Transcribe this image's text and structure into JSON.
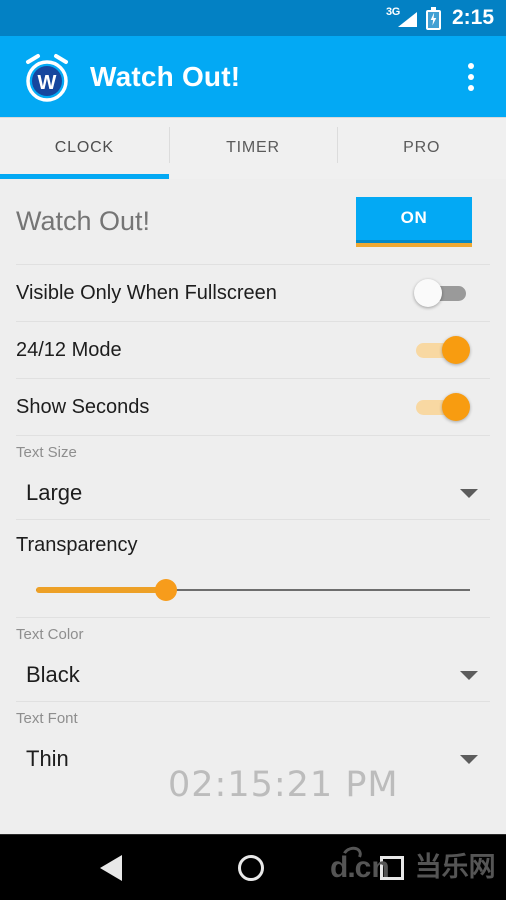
{
  "status_bar": {
    "network": "3G",
    "signal_icon": "signal-bars-icon",
    "battery_icon": "battery-charging-icon",
    "time": "2:15"
  },
  "app_bar": {
    "logo_icon": "alarm-clock-w-logo",
    "logo_letter": "W",
    "title": "Watch Out!",
    "overflow_icon": "overflow-menu-icon",
    "background_color": "#03a9f4"
  },
  "tabs": [
    {
      "label": "CLOCK",
      "active": true
    },
    {
      "label": "TIMER",
      "active": false
    },
    {
      "label": "PRO",
      "active": false
    }
  ],
  "settings": {
    "main_toggle": {
      "label": "Watch Out!",
      "button_label": "ON",
      "button_color": "#03a9f4",
      "accent_color": "#efa832"
    },
    "switches": [
      {
        "label": "Visible Only When Fullscreen",
        "state": "off"
      },
      {
        "label": "24/12 Mode",
        "state": "on"
      },
      {
        "label": "Show Seconds",
        "state": "on"
      }
    ],
    "text_size": {
      "caption": "Text Size",
      "value": "Large",
      "caret_icon": "chevron-down-icon"
    },
    "transparency": {
      "label": "Transparency",
      "value_percent": 30,
      "fill_color": "#eda026"
    },
    "text_color": {
      "caption": "Text Color",
      "value": "Black",
      "caret_icon": "chevron-down-icon"
    },
    "text_font": {
      "caption": "Text Font",
      "value": "Thin",
      "caret_icon": "chevron-down-icon"
    },
    "clock_preview": "02:15:21 PM"
  },
  "nav_bar": {
    "back_icon": "back-triangle-icon",
    "home_icon": "home-circle-icon",
    "recents_icon": "recents-square-icon",
    "watermark_d": "d.c",
    "watermark_n": "n",
    "watermark_cn": "当乐网"
  }
}
